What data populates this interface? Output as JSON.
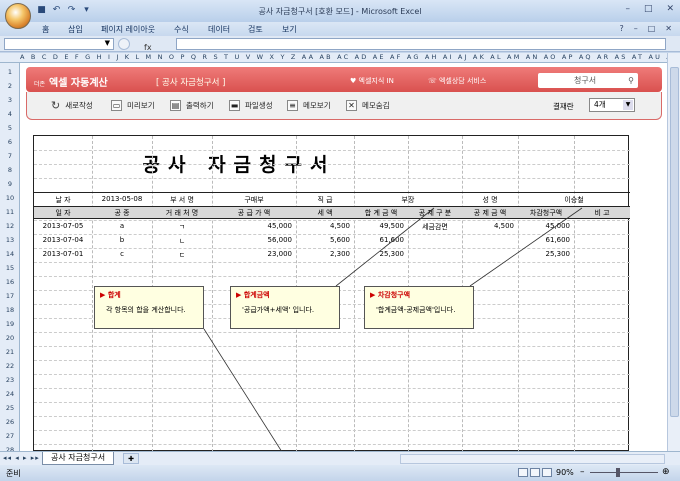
{
  "window": {
    "title": "공사 자금청구서 [호환 모드] - Microsoft Excel"
  },
  "qat": {
    "save_icon": "save-icon",
    "undo_icon": "undo-icon",
    "redo_icon": "redo-icon"
  },
  "ribbon_tabs": [
    "홈",
    "삽입",
    "페이지 레이아웃",
    "수식",
    "데이터",
    "검토",
    "보기"
  ],
  "formula": {
    "fx": "fx",
    "value": ""
  },
  "columns": "A B C D E F G H I J K L M N O P Q R S T U V W X Y Z AA AB AC AD AE AF AG AH AI AJ AK AL AM AN AO AP AQ AR AS AT AU AV AW AX AY AZ BA BB BC",
  "rows": [
    "1",
    "2",
    "3",
    "4",
    "5",
    "6",
    "7",
    "8",
    "9",
    "10",
    "11",
    "12",
    "13",
    "14",
    "15",
    "16",
    "17",
    "18",
    "19",
    "20",
    "21",
    "22",
    "23",
    "24",
    "25",
    "26",
    "27",
    "28"
  ],
  "banner": {
    "brand_small": "더존",
    "brand": "엑셀 자동계산",
    "tag": "[ 공사 자금청구서 ]",
    "link1": "엑셀지식 IN",
    "link2": "엑셀상담 서비스",
    "search": "청구서"
  },
  "toolbar": {
    "new": "새로작성",
    "preview": "미리보기",
    "print": "출력하기",
    "file": "파일생성",
    "memo_show": "메모보기",
    "memo_hide": "메모숨김",
    "approval_label": "결재란",
    "approval_value": "4개"
  },
  "form": {
    "title": "공사 자금청구서",
    "date_label": "날 자",
    "date_value": "2013-05-08",
    "dept_label": "부 서 명",
    "dept_value": "구매부",
    "rank_label": "직 급",
    "rank_value": "부장",
    "name_label": "성 명",
    "name_value": "이승철",
    "headers": [
      "일 자",
      "공 종",
      "거 래 처 명",
      "공 급 가 액",
      "세 액",
      "합 계 금 액",
      "공 제 구 분",
      "공 제 금 액",
      "차감청구액",
      "비 고"
    ],
    "rows": [
      [
        "2013-07-05",
        "a",
        "ㄱ",
        "45,000",
        "4,500",
        "49,500",
        "세금감면",
        "4,500",
        "45,000",
        ""
      ],
      [
        "2013-07-04",
        "b",
        "ㄴ",
        "56,000",
        "5,600",
        "61,600",
        "",
        "",
        "61,600",
        ""
      ],
      [
        "2013-07-01",
        "c",
        "ㄷ",
        "23,000",
        "2,300",
        "25,300",
        "",
        "",
        "25,300",
        ""
      ]
    ]
  },
  "notes": [
    {
      "title": "합계",
      "text": "각 항목의 합을 계산합니다."
    },
    {
      "title": "합계금액",
      "text": "'공급가액+세액' 입니다."
    },
    {
      "title": "차감청구액",
      "text": "'합계금액-공제금액'입니다."
    }
  ],
  "sheet_tab": "공사 자금청구서",
  "status": {
    "ready": "준비",
    "zoom": "90%"
  }
}
